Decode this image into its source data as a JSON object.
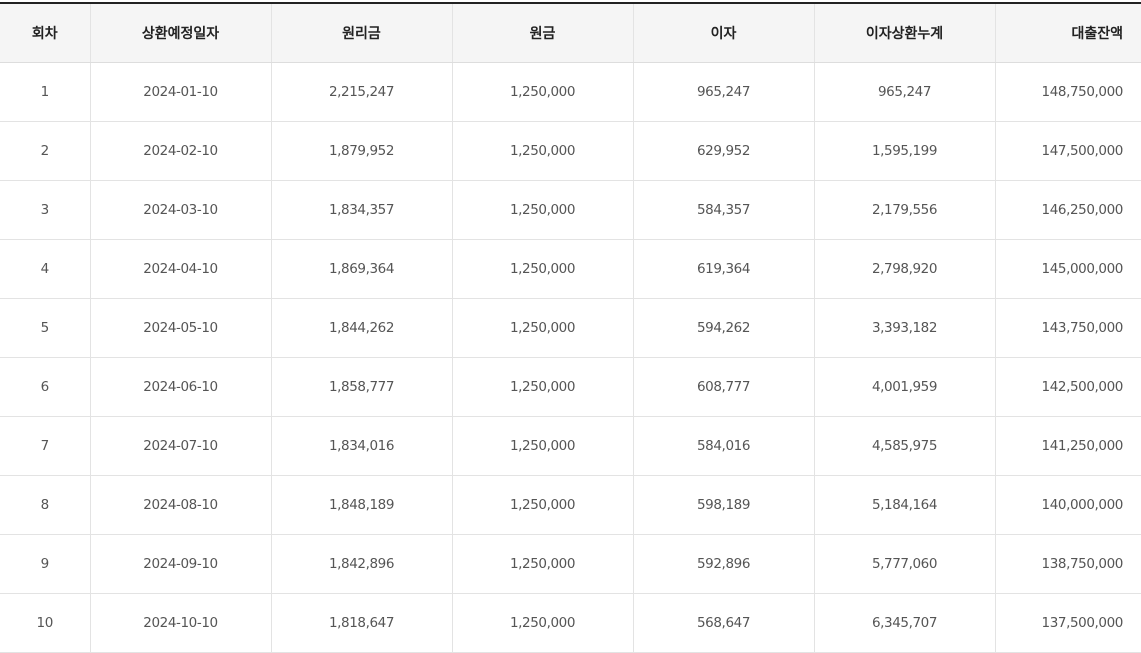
{
  "table": {
    "headers": {
      "round": "회차",
      "date": "상환예정일자",
      "total": "원리금",
      "principal": "원금",
      "interest": "이자",
      "cumulative_interest": "이자상환누계",
      "balance": "대출잔액"
    },
    "rows": [
      {
        "round": "1",
        "date": "2024-01-10",
        "total": "2,215,247",
        "principal": "1,250,000",
        "interest": "965,247",
        "cumulative_interest": "965,247",
        "balance": "148,750,000"
      },
      {
        "round": "2",
        "date": "2024-02-10",
        "total": "1,879,952",
        "principal": "1,250,000",
        "interest": "629,952",
        "cumulative_interest": "1,595,199",
        "balance": "147,500,000"
      },
      {
        "round": "3",
        "date": "2024-03-10",
        "total": "1,834,357",
        "principal": "1,250,000",
        "interest": "584,357",
        "cumulative_interest": "2,179,556",
        "balance": "146,250,000"
      },
      {
        "round": "4",
        "date": "2024-04-10",
        "total": "1,869,364",
        "principal": "1,250,000",
        "interest": "619,364",
        "cumulative_interest": "2,798,920",
        "balance": "145,000,000"
      },
      {
        "round": "5",
        "date": "2024-05-10",
        "total": "1,844,262",
        "principal": "1,250,000",
        "interest": "594,262",
        "cumulative_interest": "3,393,182",
        "balance": "143,750,000"
      },
      {
        "round": "6",
        "date": "2024-06-10",
        "total": "1,858,777",
        "principal": "1,250,000",
        "interest": "608,777",
        "cumulative_interest": "4,001,959",
        "balance": "142,500,000"
      },
      {
        "round": "7",
        "date": "2024-07-10",
        "total": "1,834,016",
        "principal": "1,250,000",
        "interest": "584,016",
        "cumulative_interest": "4,585,975",
        "balance": "141,250,000"
      },
      {
        "round": "8",
        "date": "2024-08-10",
        "total": "1,848,189",
        "principal": "1,250,000",
        "interest": "598,189",
        "cumulative_interest": "5,184,164",
        "balance": "140,000,000"
      },
      {
        "round": "9",
        "date": "2024-09-10",
        "total": "1,842,896",
        "principal": "1,250,000",
        "interest": "592,896",
        "cumulative_interest": "5,777,060",
        "balance": "138,750,000"
      },
      {
        "round": "10",
        "date": "2024-10-10",
        "total": "1,818,647",
        "principal": "1,250,000",
        "interest": "568,647",
        "cumulative_interest": "6,345,707",
        "balance": "137,500,000"
      }
    ]
  }
}
